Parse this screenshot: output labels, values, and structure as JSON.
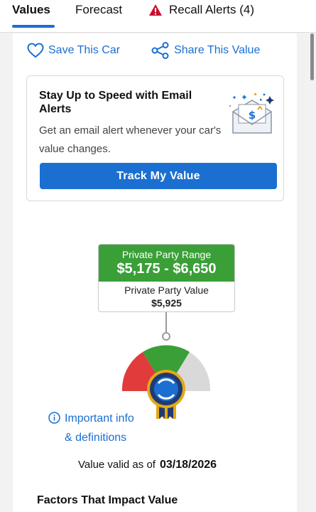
{
  "tabs": {
    "values": "Values",
    "forecast": "Forecast",
    "recall": "Recall Alerts (4)"
  },
  "actions": {
    "save": "Save This Car",
    "share": "Share This Value"
  },
  "email_card": {
    "title": "Stay Up to Speed with Email Alerts",
    "description": "Get an email alert whenever your car's value changes.",
    "button": "Track My Value"
  },
  "value_box": {
    "range_label": "Private Party Range",
    "range_value": "$5,175 - $6,650",
    "value_label": "Private Party Value",
    "value": "$5,925"
  },
  "info": {
    "line1": "Important info",
    "line2": "& definitions"
  },
  "valid": {
    "label": "Value valid as of",
    "date": "03/18/2026"
  },
  "factors_title": "Factors That Impact Value",
  "colors": {
    "accent": "#1a6fd1",
    "range_green": "#3a9f37",
    "gauge_red": "#e23b3b",
    "gauge_gray": "#d9d9d9",
    "badge_navy": "#1f3b73",
    "badge_gold": "#e3a81a"
  }
}
